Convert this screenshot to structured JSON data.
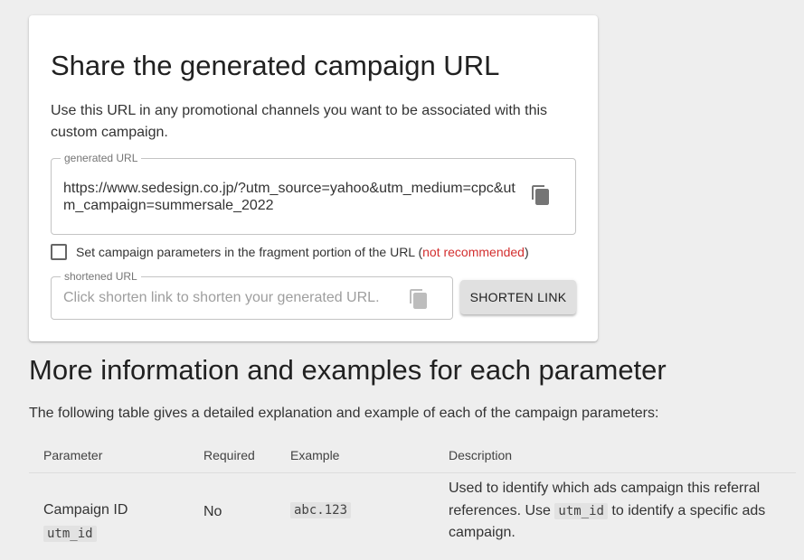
{
  "share_card": {
    "title": "Share the generated campaign URL",
    "description": "Use this URL in any promotional channels you want to be associated with this custom campaign.",
    "generated_url": {
      "legend": "generated URL",
      "value": "https://www.sedesign.co.jp/?utm_source=yahoo&utm_medium=cpc&utm_campaign=summersale_2022",
      "copy_icon": "copy-icon"
    },
    "fragment_checkbox": {
      "checked": false,
      "label_prefix": "Set campaign parameters in the fragment portion of the URL (",
      "label_warning": "not recommended",
      "label_suffix": ")"
    },
    "shortened_url": {
      "legend": "shortened URL",
      "placeholder": "Click shorten link to shorten your generated URL.",
      "copy_icon": "copy-icon"
    },
    "shorten_button": "SHORTEN LINK"
  },
  "params_section": {
    "title": "More information and examples for each parameter",
    "description": "The following table gives a detailed explanation and example of each of the campaign parameters:",
    "headers": [
      "Parameter",
      "Required",
      "Example",
      "Description"
    ],
    "rows": [
      {
        "name": "Campaign ID",
        "code": "utm_id",
        "required": "No",
        "example": "abc.123",
        "description_before": "Used to identify which ads campaign this referral references. Use ",
        "description_code": "utm_id",
        "description_after": " to identify a specific ads campaign."
      }
    ]
  },
  "colors": {
    "background": "#eeeeee",
    "card": "#ffffff",
    "warning": "#d32f2f",
    "button": "#e0e0e0"
  }
}
